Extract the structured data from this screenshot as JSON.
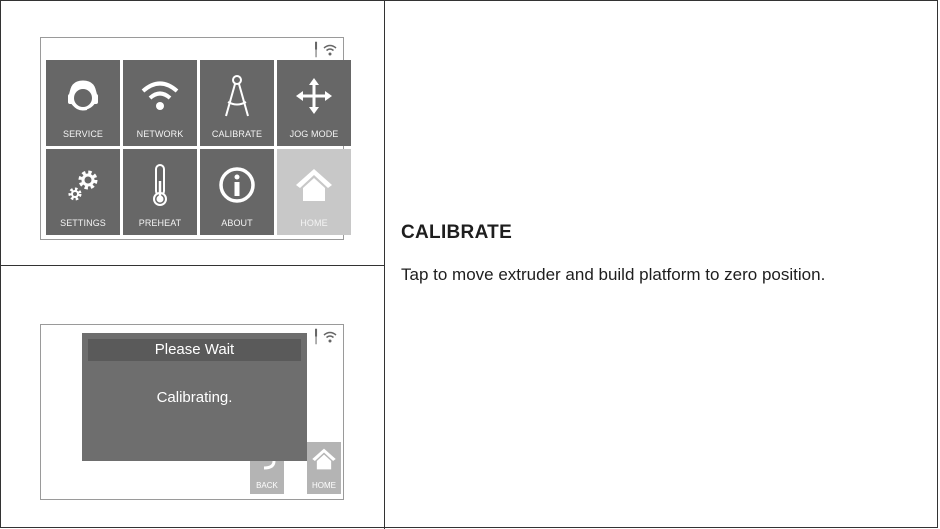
{
  "menu_screen": {
    "tiles": [
      {
        "label": "SERVICE",
        "icon": "headset-icon"
      },
      {
        "label": "NETWORK",
        "icon": "wifi-icon"
      },
      {
        "label": "CALIBRATE",
        "icon": "compass-icon"
      },
      {
        "label": "JOG MODE",
        "icon": "move-arrows-icon"
      },
      {
        "label": "SETTINGS",
        "icon": "gears-icon"
      },
      {
        "label": "PREHEAT",
        "icon": "thermometer-icon"
      },
      {
        "label": "ABOUT",
        "icon": "info-icon"
      },
      {
        "label": "HOME",
        "icon": "home-icon"
      }
    ]
  },
  "calibrating_screen": {
    "dialog_title": "Please Wait",
    "dialog_message": "Calibrating.",
    "back_label": "BACK",
    "home_label": "HOME"
  },
  "section": {
    "heading": "CALIBRATE",
    "description": "Tap to move extruder and build platform to zero position."
  },
  "colors": {
    "tile": "#676767",
    "tile_disabled": "#c8c8c8",
    "dialog": "#6e6e6e"
  }
}
